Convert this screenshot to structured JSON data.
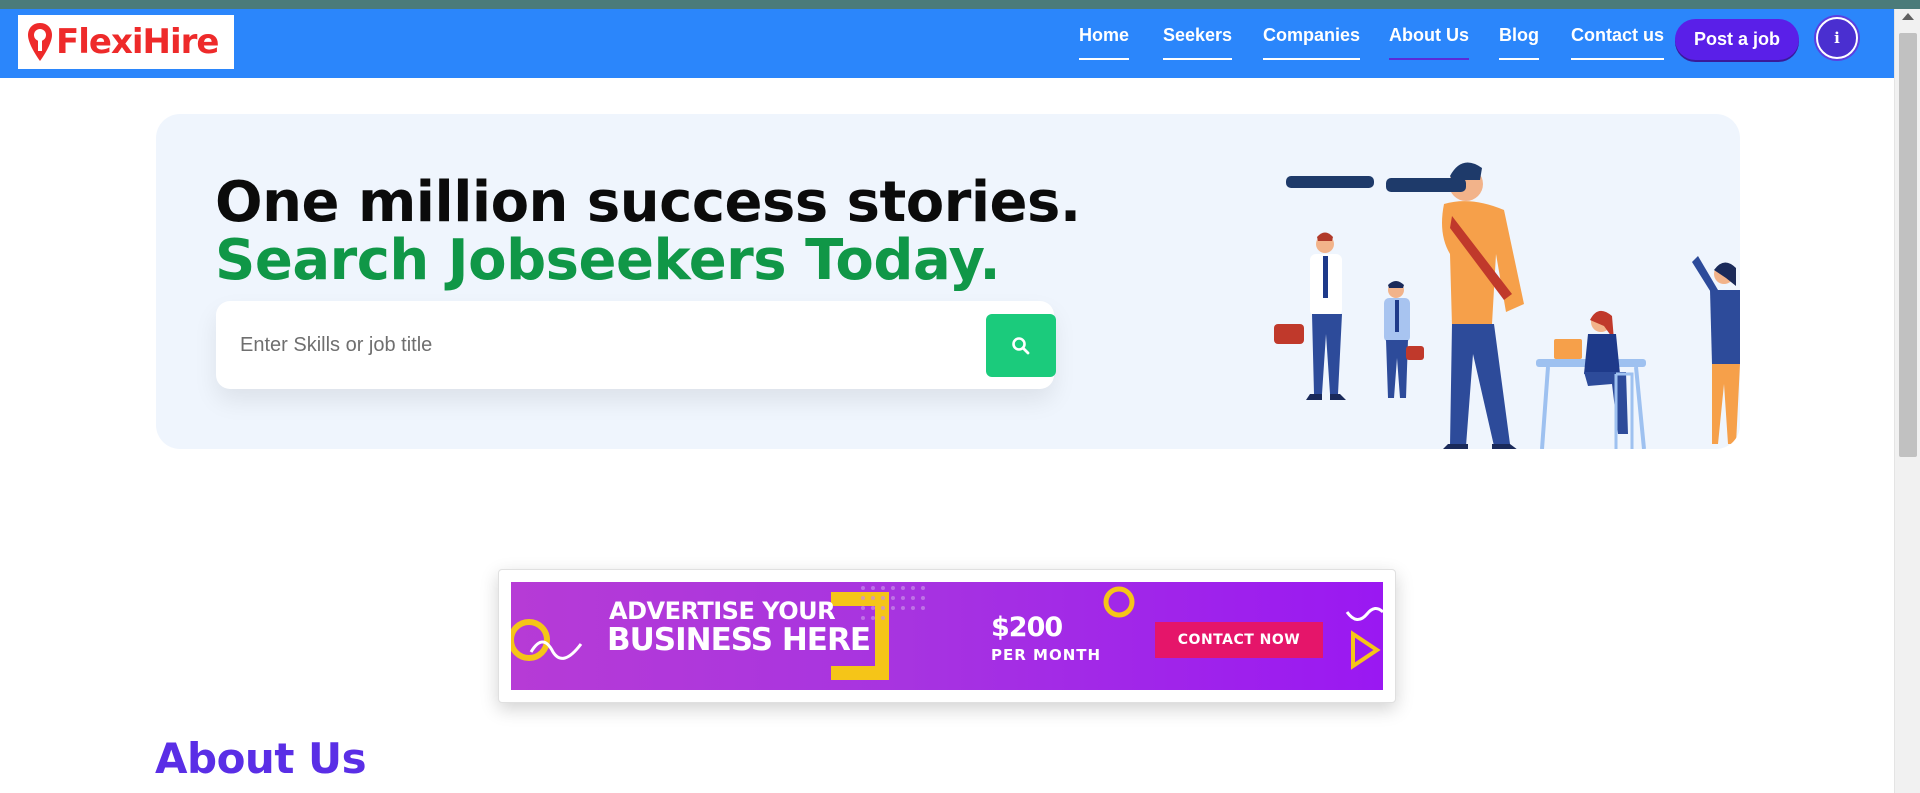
{
  "brand": {
    "name": "FlexiHire",
    "accent": "#2b86fb",
    "logo_color": "#ee2a2a"
  },
  "nav": {
    "items": [
      {
        "label": "Home"
      },
      {
        "label": "Seekers"
      },
      {
        "label": "Companies"
      },
      {
        "label": "About Us",
        "active": true
      },
      {
        "label": "Blog"
      },
      {
        "label": "Contact us"
      }
    ],
    "post_job_label": "Post a job",
    "profile_icon": "info-icon"
  },
  "hero": {
    "headline": "One million success stories.",
    "subheadline": "Search Jobseekers Today.",
    "search": {
      "placeholder": "Enter Skills or job title",
      "value": "",
      "button_icon": "search-icon"
    },
    "illustration": "people-with-telescope-illustration"
  },
  "ad": {
    "line1": "ADVERTISE YOUR",
    "line2": "BUSINESS HERE",
    "price": "$200",
    "period": "PER MONTH",
    "cta": "CONTACT NOW"
  },
  "about": {
    "title": "About Us"
  }
}
